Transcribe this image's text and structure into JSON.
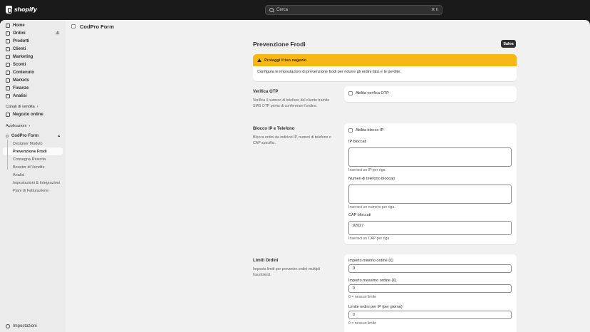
{
  "topbar": {
    "brand": "shopify",
    "search_placeholder": "Cerca",
    "search_shortcut": "⌘ K"
  },
  "sidebar": {
    "items": [
      {
        "label": "Home",
        "icon": "home-icon"
      },
      {
        "label": "Ordini",
        "icon": "orders-icon",
        "badge": "4"
      },
      {
        "label": "Prodotti",
        "icon": "tag-icon"
      },
      {
        "label": "Clienti",
        "icon": "person-icon"
      },
      {
        "label": "Marketing",
        "icon": "target-icon"
      },
      {
        "label": "Sconti",
        "icon": "discount-icon"
      },
      {
        "label": "Contenuto",
        "icon": "content-icon"
      },
      {
        "label": "Markets",
        "icon": "globe-icon"
      },
      {
        "label": "Finanze",
        "icon": "bank-icon"
      },
      {
        "label": "Analisi",
        "icon": "chart-icon"
      }
    ],
    "channels_heading": "Canali di vendita",
    "channels": [
      {
        "label": "Negozio online",
        "icon": "store-icon"
      }
    ],
    "apps_heading": "Applicazioni",
    "app_name": "CodPro Form",
    "app_subitems": [
      "Designer Modulo",
      "Prevenzione Frodi",
      "Consegna Riuscita",
      "Booster di Vendite",
      "Analisi",
      "Impostazioni & Integrazioni",
      "Piani di Fatturazione"
    ],
    "active_subitem": "Prevenzione Frodi",
    "settings_label": "Impostazioni"
  },
  "app_header": {
    "title": "CodPro Form"
  },
  "page": {
    "title": "Prevenzione Frodi",
    "save_label": "Salva"
  },
  "banner": {
    "title": "Proteggi il tuo negozio",
    "text": "Configura le impostazioni di prevenzione frodi per ridurre gli ordini falsi e le perdite.",
    "color": "#f5b816"
  },
  "otp": {
    "title": "Verifica OTP",
    "desc": "Verifica il numero di telefono del cliente tramite SMS OTP prima di confermare l'ordine.",
    "checkbox_label": "Abilita verifica OTP"
  },
  "block": {
    "title": "Blocco IP e Telefono",
    "desc": "Blocca ordini da indirizzi IP, numeri di telefono o CAP specifici.",
    "checkbox_label": "Abilita blocco IP",
    "ip_label": "IP bloccati",
    "ip_help": "Inserisci un IP per riga",
    "phone_label": "Numeri di telefono bloccati",
    "phone_help": "Inserisci un numero per riga",
    "cap_label": "CAP bloccati",
    "cap_value": "92027",
    "cap_help": "Inserisci un CAP per riga"
  },
  "limits": {
    "title": "Limiti Ordini",
    "desc": "Imposta limiti per prevenire ordini multipli fraudolenti.",
    "min_label": "Importo minimo ordine (€)",
    "min_value": "0",
    "max_label": "Importo massimo ordine (€)",
    "max_value": "0",
    "max_help": "0 = nessun limite",
    "perip_label": "Limite ordini per IP (per giorno)",
    "perip_value": "0",
    "perip_help": "0 = nessun limite"
  }
}
